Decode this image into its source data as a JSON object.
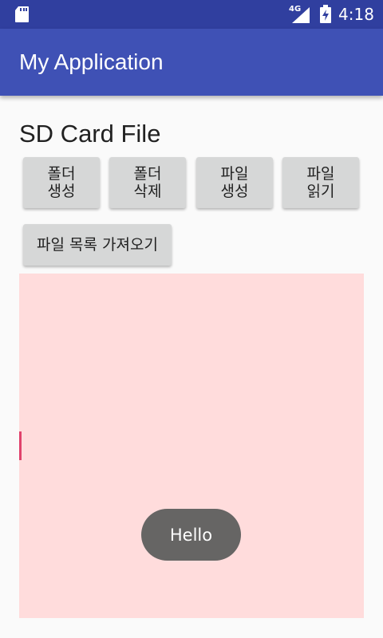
{
  "status_bar": {
    "network": "4G",
    "time": "4:18",
    "icons": [
      "sd-card-icon",
      "signal-icon",
      "battery-charging-icon"
    ]
  },
  "app_bar": {
    "title": "My Application"
  },
  "main": {
    "heading": "SD Card File",
    "buttons": {
      "create_folder": "폴더 생성",
      "delete_folder": "폴더 삭제",
      "create_file": "파일 생성",
      "read_file": "파일 읽기",
      "get_file_list": "파일 목록 가져오기"
    }
  },
  "toast": {
    "text": "Hello"
  },
  "colors": {
    "status_bar": "#303f9f",
    "app_bar": "#3f51b5",
    "list_background": "#ffdcdc",
    "accent": "#e0426c",
    "toast_background": "#666564"
  }
}
